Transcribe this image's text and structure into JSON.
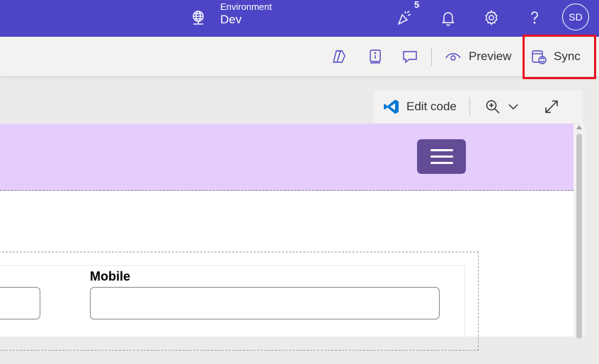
{
  "topbar": {
    "environment_label": "Environment",
    "environment_value": "Dev",
    "notification_badge": "5",
    "user_initials": "SD",
    "icons": [
      "globe-icon",
      "celebrate-icon",
      "bell-icon",
      "gear-icon",
      "help-icon"
    ]
  },
  "commandbar": {
    "icons": [
      "copilot-icon",
      "info-book-icon",
      "comment-icon"
    ],
    "preview_label": "Preview",
    "sync_label": "Sync",
    "highlight_color": "#e81123"
  },
  "canvas_toolbar": {
    "edit_code_label": "Edit code",
    "icons": [
      "vscode-icon",
      "zoom-in-icon",
      "chevron-down-icon",
      "expand-icon"
    ]
  },
  "site": {
    "header_color": "#e4ccfd",
    "menu_button_color": "#634c96"
  },
  "form": {
    "mobile_label": "Mobile",
    "mobile_value": ""
  },
  "colors": {
    "topbar": "#4d45c6",
    "commandbar": "#f3f2f1"
  }
}
